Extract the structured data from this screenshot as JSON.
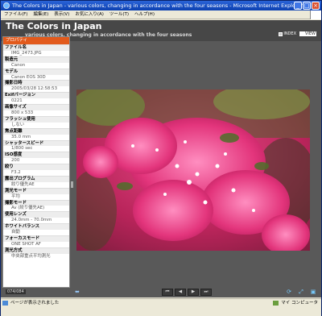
{
  "window": {
    "title": "The Colors in Japan - various colors, changing in accordance with the four seasons - Microsoft Internet Explorer",
    "minimize": "_",
    "maximize": "□",
    "close": "×"
  },
  "menu": [
    "ファイル(F)",
    "編集(E)",
    "表示(V)",
    "お気に入り(A)",
    "ツール(T)",
    "ヘルプ(H)"
  ],
  "app": {
    "title": "The Colors in Japan",
    "subtitle": "various colors, changing in accordance with the four seasons",
    "views": [
      {
        "label": "INDEX",
        "active": false
      },
      {
        "label": "VIEW",
        "active": true
      }
    ]
  },
  "properties": {
    "header": "プロパティ",
    "items": [
      {
        "label": "ファイル名",
        "value": "IMG_2473.JPG"
      },
      {
        "label": "製造元",
        "value": "Canon"
      },
      {
        "label": "モデル",
        "value": "Canon EOS 30D"
      },
      {
        "label": "撮影日時",
        "value": "2005/03/28 12:58:53"
      },
      {
        "label": "Exifバージョン",
        "value": "0221"
      },
      {
        "label": "画像サイズ",
        "value": "800 x 533"
      },
      {
        "label": "フラッシュ使用",
        "value": "しない"
      },
      {
        "label": "焦点距離",
        "value": "35.0 mm"
      },
      {
        "label": "シャッタースピード",
        "value": "1/800 sec"
      },
      {
        "label": "ISO感度",
        "value": "200"
      },
      {
        "label": "絞り",
        "value": "F3.2"
      },
      {
        "label": "露出プログラム",
        "value": "絞り優先AE"
      },
      {
        "label": "測光モード",
        "value": "平均"
      },
      {
        "label": "撮影モード",
        "value": "Av (絞り優先AE)"
      },
      {
        "label": "使用レンズ",
        "value": "24.0mm - 70.0mm"
      },
      {
        "label": "ホワイトバランス",
        "value": "自動"
      },
      {
        "label": "フォーカスモード",
        "value": "ONE SHOT AF"
      },
      {
        "label": "測光方式",
        "value": "中央部重点平均測光"
      }
    ]
  },
  "image": {
    "subject": "pink bougainvillea flowers",
    "colors": [
      "#d9306d",
      "#f06aa5",
      "#5f7c33",
      "#2e3a1e"
    ]
  },
  "nav": {
    "counter": "074/084",
    "transport": [
      "⏮",
      "◀",
      "▶",
      "⏭"
    ]
  },
  "status": {
    "text": "ページが表示されました",
    "zone": "マイ コンピュータ"
  }
}
